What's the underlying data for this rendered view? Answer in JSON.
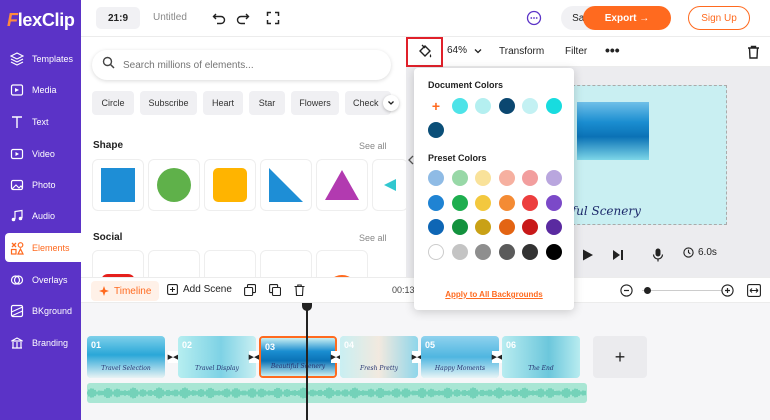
{
  "app": {
    "logo_text": "FlexClip",
    "project_title": "Untitled",
    "aspect_ratio": "21:9",
    "brand_color": "#5b33c7",
    "accent_color": "#ff6a1f"
  },
  "topbar": {
    "save_label": "Save",
    "export_label": "Export →",
    "signup_label": "Sign Up",
    "icons": [
      "undo-icon",
      "redo-icon",
      "fullscreen-icon",
      "chat-icon"
    ]
  },
  "sidebar": {
    "items": [
      {
        "label": "Templates",
        "icon": "templates-icon"
      },
      {
        "label": "Media",
        "icon": "media-icon"
      },
      {
        "label": "Text",
        "icon": "text-icon"
      },
      {
        "label": "Video",
        "icon": "video-icon"
      },
      {
        "label": "Photo",
        "icon": "photo-icon"
      },
      {
        "label": "Audio",
        "icon": "audio-icon"
      },
      {
        "label": "Elements",
        "icon": "elements-icon",
        "active": true
      },
      {
        "label": "Overlays",
        "icon": "overlays-icon"
      },
      {
        "label": "BKground",
        "icon": "background-icon"
      },
      {
        "label": "Branding",
        "icon": "branding-icon"
      }
    ]
  },
  "panel": {
    "search_placeholder": "Search millions of elements...",
    "chips": [
      "Circle",
      "Subscribe",
      "Heart",
      "Star",
      "Flowers",
      "Check"
    ],
    "shape_title": "Shape",
    "social_title": "Social",
    "see_all": "See all"
  },
  "toolbar": {
    "zoom": "64%",
    "transform_label": "Transform",
    "filter_label": "Filter"
  },
  "popover": {
    "document_title": "Document Colors",
    "document_colors": [
      "#4ee3e8",
      "#b4eff0",
      "#0b4770",
      "#c3f1f3",
      "#18dcdf",
      "#0b4f78"
    ],
    "preset_title": "Preset Colors",
    "preset_colors": [
      "#8fbbe5",
      "#98d8a7",
      "#f9e29a",
      "#f6b0a0",
      "#f29e9e",
      "#b9a6de",
      "#1f83d3",
      "#1eae4f",
      "#f3c83e",
      "#f48b34",
      "#ec3e3e",
      "#7b49c8",
      "#0e66b5",
      "#13923e",
      "#c9a116",
      "#e36413",
      "#c81919",
      "#5a2aa0",
      "#ffffff",
      "#c4c4c4",
      "#8e8e8e",
      "#5b5b5b",
      "#333333",
      "#000000"
    ],
    "apply_label": "Apply to All Backgrounds"
  },
  "preview": {
    "scene_caption": "tiful Scenery",
    "duration": "6.0s"
  },
  "timeline": {
    "tab_label": "Timeline",
    "add_scene_label": "Add Scene",
    "current_time": "00:13",
    "clips": [
      {
        "num": "01",
        "caption": "Travel Selection"
      },
      {
        "num": "02",
        "caption": "Travel Display"
      },
      {
        "num": "03",
        "caption": "Beautiful Scenery",
        "selected": true
      },
      {
        "num": "04",
        "caption": "Fresh Pretty"
      },
      {
        "num": "05",
        "caption": "Happy Moments"
      },
      {
        "num": "06",
        "caption": "The End"
      }
    ]
  }
}
